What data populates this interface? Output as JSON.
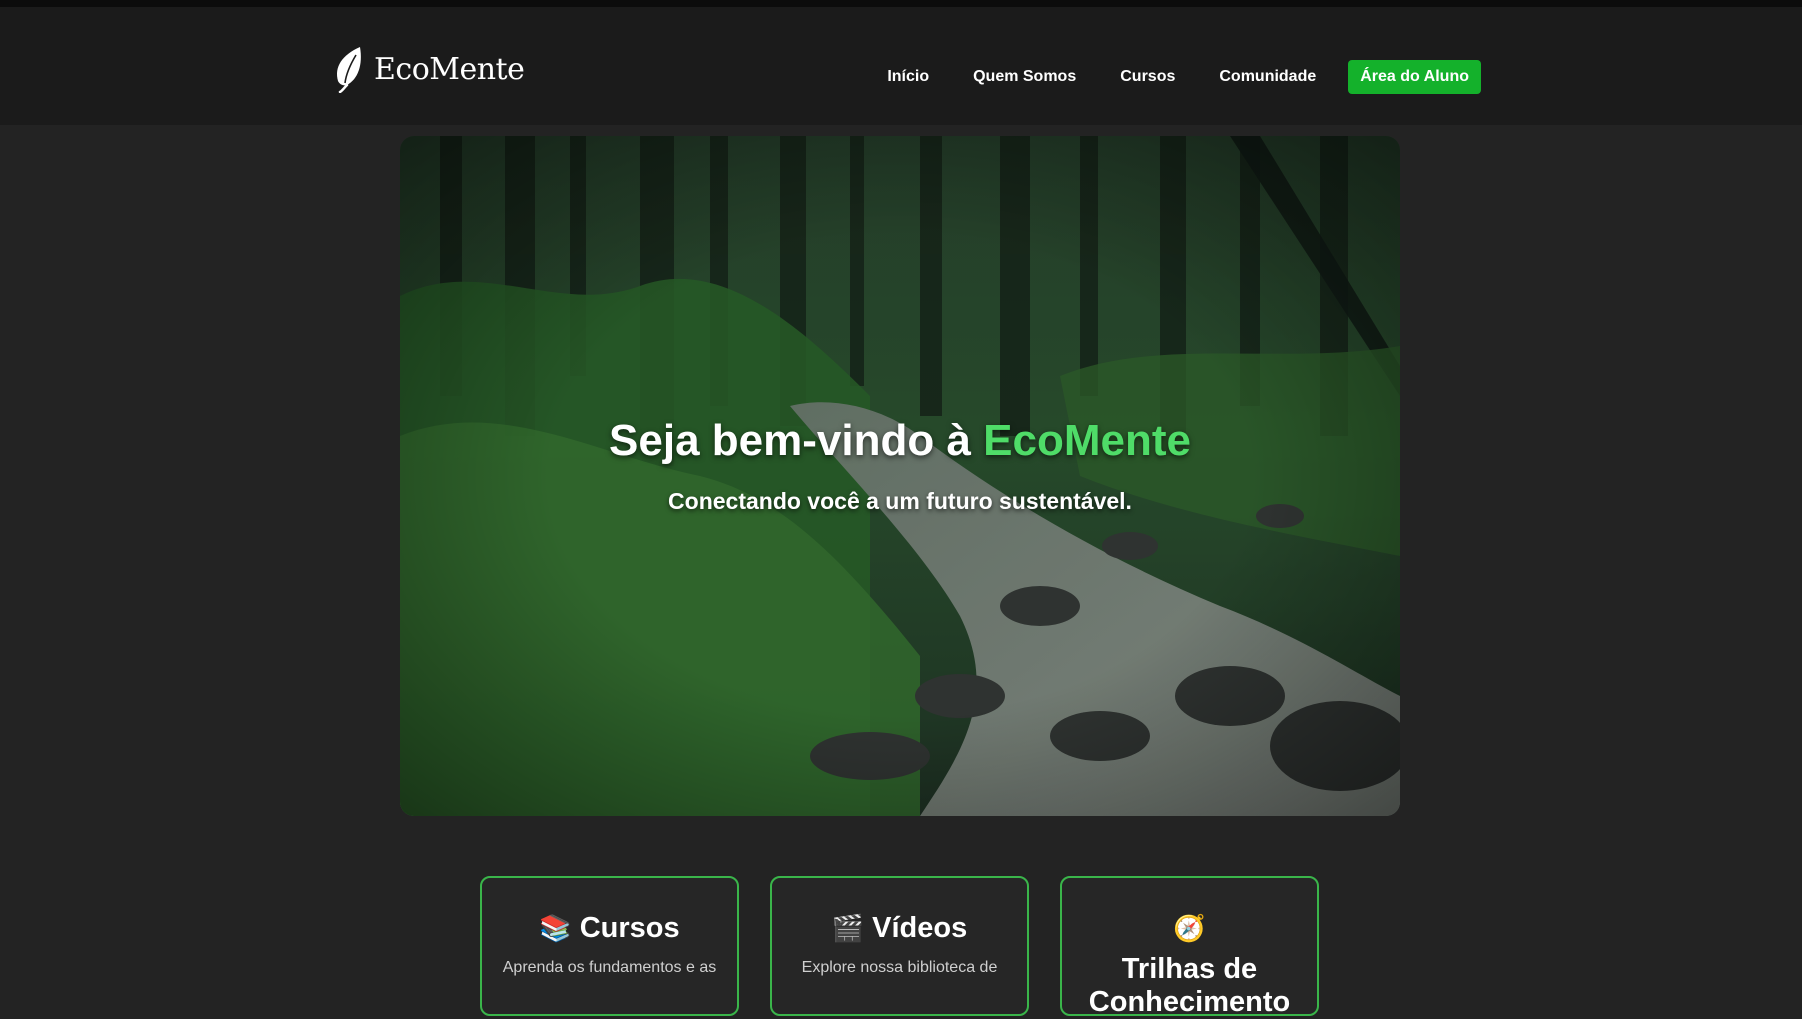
{
  "header": {
    "logo_text": "EcoMente",
    "nav": [
      {
        "label": "Início"
      },
      {
        "label": "Quem Somos"
      },
      {
        "label": "Cursos"
      },
      {
        "label": "Comunidade"
      }
    ],
    "cta_label": "Área do Aluno"
  },
  "hero": {
    "title_prefix": "Seja bem-vindo à ",
    "title_accent": "EcoMente",
    "subtitle": "Conectando você a um futuro sustentável."
  },
  "cards": [
    {
      "icon": "📚",
      "icon_name": "books-icon",
      "title": "Cursos",
      "text": "Aprenda os fundamentos e as"
    },
    {
      "icon": "🎬",
      "icon_name": "clapperboard-icon",
      "title": "Vídeos",
      "text": "Explore nossa biblioteca de"
    },
    {
      "icon": "🧭",
      "icon_name": "compass-icon",
      "title": "Trilhas de Conhecimento",
      "text": ""
    }
  ],
  "colors": {
    "accent_green": "#4fdc68",
    "cta_green": "#14b12b",
    "card_border": "#3ab54a",
    "background": "#232323"
  }
}
